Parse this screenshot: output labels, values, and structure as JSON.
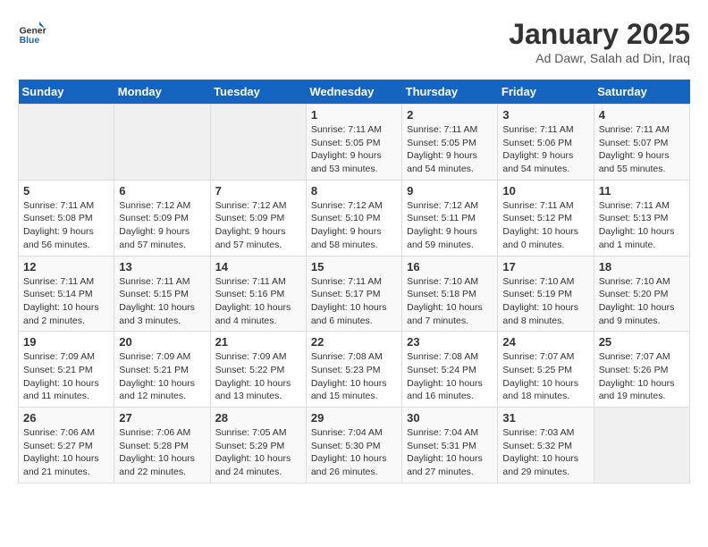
{
  "header": {
    "logo_general": "General",
    "logo_blue": "Blue",
    "title": "January 2025",
    "subtitle": "Ad Dawr, Salah ad Din, Iraq"
  },
  "calendar": {
    "weekdays": [
      "Sunday",
      "Monday",
      "Tuesday",
      "Wednesday",
      "Thursday",
      "Friday",
      "Saturday"
    ],
    "weeks": [
      [
        {
          "day": "",
          "empty": true
        },
        {
          "day": "",
          "empty": true
        },
        {
          "day": "",
          "empty": true
        },
        {
          "day": "1",
          "sunrise": "7:11 AM",
          "sunset": "5:05 PM",
          "daylight": "9 hours and 53 minutes."
        },
        {
          "day": "2",
          "sunrise": "7:11 AM",
          "sunset": "5:05 PM",
          "daylight": "9 hours and 54 minutes."
        },
        {
          "day": "3",
          "sunrise": "7:11 AM",
          "sunset": "5:06 PM",
          "daylight": "9 hours and 54 minutes."
        },
        {
          "day": "4",
          "sunrise": "7:11 AM",
          "sunset": "5:07 PM",
          "daylight": "9 hours and 55 minutes."
        }
      ],
      [
        {
          "day": "5",
          "sunrise": "7:11 AM",
          "sunset": "5:08 PM",
          "daylight": "9 hours and 56 minutes."
        },
        {
          "day": "6",
          "sunrise": "7:12 AM",
          "sunset": "5:09 PM",
          "daylight": "9 hours and 57 minutes."
        },
        {
          "day": "7",
          "sunrise": "7:12 AM",
          "sunset": "5:09 PM",
          "daylight": "9 hours and 57 minutes."
        },
        {
          "day": "8",
          "sunrise": "7:12 AM",
          "sunset": "5:10 PM",
          "daylight": "9 hours and 58 minutes."
        },
        {
          "day": "9",
          "sunrise": "7:12 AM",
          "sunset": "5:11 PM",
          "daylight": "9 hours and 59 minutes."
        },
        {
          "day": "10",
          "sunrise": "7:11 AM",
          "sunset": "5:12 PM",
          "daylight": "10 hours and 0 minutes."
        },
        {
          "day": "11",
          "sunrise": "7:11 AM",
          "sunset": "5:13 PM",
          "daylight": "10 hours and 1 minute."
        }
      ],
      [
        {
          "day": "12",
          "sunrise": "7:11 AM",
          "sunset": "5:14 PM",
          "daylight": "10 hours and 2 minutes."
        },
        {
          "day": "13",
          "sunrise": "7:11 AM",
          "sunset": "5:15 PM",
          "daylight": "10 hours and 3 minutes."
        },
        {
          "day": "14",
          "sunrise": "7:11 AM",
          "sunset": "5:16 PM",
          "daylight": "10 hours and 4 minutes."
        },
        {
          "day": "15",
          "sunrise": "7:11 AM",
          "sunset": "5:17 PM",
          "daylight": "10 hours and 6 minutes."
        },
        {
          "day": "16",
          "sunrise": "7:10 AM",
          "sunset": "5:18 PM",
          "daylight": "10 hours and 7 minutes."
        },
        {
          "day": "17",
          "sunrise": "7:10 AM",
          "sunset": "5:19 PM",
          "daylight": "10 hours and 8 minutes."
        },
        {
          "day": "18",
          "sunrise": "7:10 AM",
          "sunset": "5:20 PM",
          "daylight": "10 hours and 9 minutes."
        }
      ],
      [
        {
          "day": "19",
          "sunrise": "7:09 AM",
          "sunset": "5:21 PM",
          "daylight": "10 hours and 11 minutes."
        },
        {
          "day": "20",
          "sunrise": "7:09 AM",
          "sunset": "5:21 PM",
          "daylight": "10 hours and 12 minutes."
        },
        {
          "day": "21",
          "sunrise": "7:09 AM",
          "sunset": "5:22 PM",
          "daylight": "10 hours and 13 minutes."
        },
        {
          "day": "22",
          "sunrise": "7:08 AM",
          "sunset": "5:23 PM",
          "daylight": "10 hours and 15 minutes."
        },
        {
          "day": "23",
          "sunrise": "7:08 AM",
          "sunset": "5:24 PM",
          "daylight": "10 hours and 16 minutes."
        },
        {
          "day": "24",
          "sunrise": "7:07 AM",
          "sunset": "5:25 PM",
          "daylight": "10 hours and 18 minutes."
        },
        {
          "day": "25",
          "sunrise": "7:07 AM",
          "sunset": "5:26 PM",
          "daylight": "10 hours and 19 minutes."
        }
      ],
      [
        {
          "day": "26",
          "sunrise": "7:06 AM",
          "sunset": "5:27 PM",
          "daylight": "10 hours and 21 minutes."
        },
        {
          "day": "27",
          "sunrise": "7:06 AM",
          "sunset": "5:28 PM",
          "daylight": "10 hours and 22 minutes."
        },
        {
          "day": "28",
          "sunrise": "7:05 AM",
          "sunset": "5:29 PM",
          "daylight": "10 hours and 24 minutes."
        },
        {
          "day": "29",
          "sunrise": "7:04 AM",
          "sunset": "5:30 PM",
          "daylight": "10 hours and 26 minutes."
        },
        {
          "day": "30",
          "sunrise": "7:04 AM",
          "sunset": "5:31 PM",
          "daylight": "10 hours and 27 minutes."
        },
        {
          "day": "31",
          "sunrise": "7:03 AM",
          "sunset": "5:32 PM",
          "daylight": "10 hours and 29 minutes."
        },
        {
          "day": "",
          "empty": true
        }
      ]
    ]
  }
}
